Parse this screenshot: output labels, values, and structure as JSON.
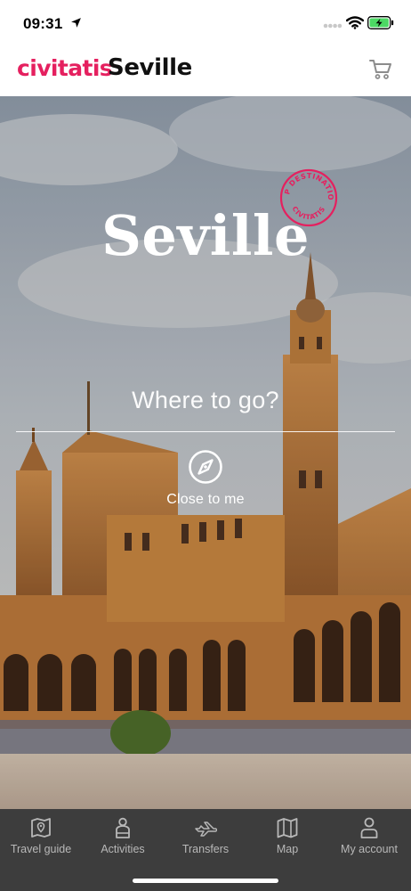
{
  "status_bar": {
    "time": "09:31",
    "icons": [
      "location-arrow-icon",
      "cellular-signal-icon",
      "wifi-icon",
      "battery-charging-icon"
    ],
    "battery_color": "#4cd964"
  },
  "header": {
    "brand": "civitatis",
    "title": "Seville",
    "cart_icon": "shopping-cart-icon",
    "brand_color": "#e5205f"
  },
  "hero": {
    "title": "Seville",
    "badge": {
      "line1": "TOP DESTINATION",
      "line2": "CIVITATIS",
      "color": "#e5205f"
    },
    "search_placeholder": "Where to go?",
    "nearby_label": "Close to me",
    "nearby_icon": "compass-icon"
  },
  "bottom_nav": {
    "background": "#3d3d3d",
    "items": [
      {
        "label": "Travel guide",
        "icon": "travel-guide-icon"
      },
      {
        "label": "Activities",
        "icon": "activities-icon"
      },
      {
        "label": "Transfers",
        "icon": "transfers-icon"
      },
      {
        "label": "Map",
        "icon": "map-icon"
      },
      {
        "label": "My account",
        "icon": "user-icon"
      }
    ]
  }
}
